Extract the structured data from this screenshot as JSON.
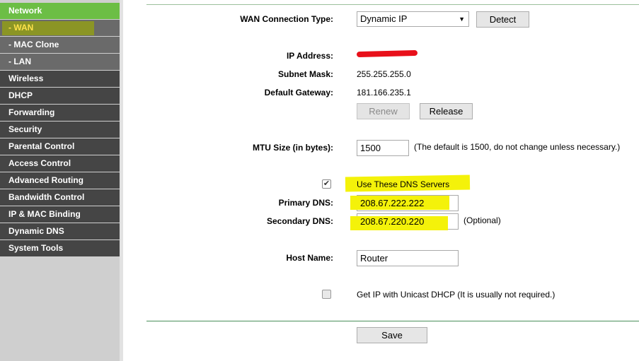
{
  "sidebar": {
    "items": [
      {
        "label": "Network"
      },
      {
        "label": "- WAN"
      },
      {
        "label": "- MAC Clone"
      },
      {
        "label": "- LAN"
      },
      {
        "label": "Wireless"
      },
      {
        "label": "DHCP"
      },
      {
        "label": "Forwarding"
      },
      {
        "label": "Security"
      },
      {
        "label": "Parental Control"
      },
      {
        "label": "Access Control"
      },
      {
        "label": "Advanced Routing"
      },
      {
        "label": "Bandwidth Control"
      },
      {
        "label": "IP & MAC Binding"
      },
      {
        "label": "Dynamic DNS"
      },
      {
        "label": "System Tools"
      }
    ]
  },
  "wan": {
    "conn_type_label": "WAN Connection Type:",
    "conn_type_value": "Dynamic IP",
    "detect_label": "Detect",
    "ip_label": "IP Address:",
    "subnet_label": "Subnet Mask:",
    "subnet_value": "255.255.255.0",
    "gateway_label": "Default Gateway:",
    "gateway_value": "181.166.235.1",
    "renew_label": "Renew",
    "release_label": "Release",
    "mtu_label": "MTU Size (in bytes):",
    "mtu_value": "1500",
    "mtu_hint": "(The default is 1500, do not change unless necessary.)",
    "use_dns_label": "Use These DNS Servers",
    "primary_dns_label": "Primary DNS:",
    "primary_dns_value": "208.67.222.222",
    "secondary_dns_label": "Secondary DNS:",
    "secondary_dns_value": "208.67.220.220",
    "optional_label": "(Optional)",
    "host_label": "Host Name:",
    "host_value": "Router",
    "unicast_label": "Get IP with Unicast DHCP (It is usually not required.)",
    "save_label": "Save",
    "dropdown_icon": "▼",
    "check_icon": "✔"
  },
  "colors": {
    "sidebar_item": "#454545",
    "sidebar_active": "#6cbe45",
    "highlight": "#f4f20a",
    "redaction": "#e8101a"
  }
}
